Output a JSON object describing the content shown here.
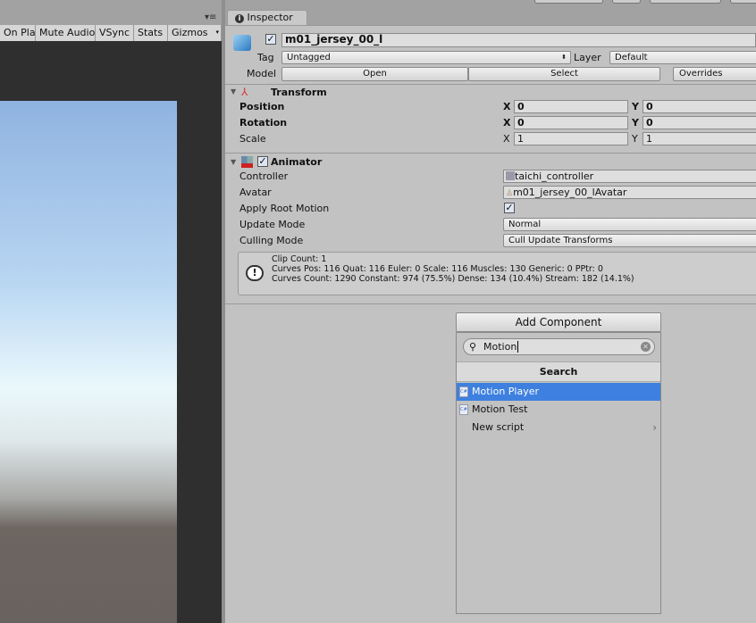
{
  "toolbar": {
    "items": [
      "On Play",
      "Mute Audio",
      "VSync",
      "Stats",
      "Gizmos"
    ]
  },
  "inspector": {
    "tab": "Inspector",
    "object_name": "m01_jersey_00_l",
    "active": true,
    "tag_label": "Tag",
    "tag": "Untagged",
    "layer_label": "Layer",
    "layer": "Default",
    "model_label": "Model",
    "open": "Open",
    "select": "Select",
    "overrides": "Overrides"
  },
  "transform": {
    "title": "Transform",
    "rows": [
      {
        "label": "Position",
        "x": "0",
        "y": "0"
      },
      {
        "label": "Rotation",
        "x": "0",
        "y": "0"
      },
      {
        "label": "Scale",
        "x": "1",
        "y": "1"
      }
    ],
    "x_label": "X",
    "y_label": "Y"
  },
  "animator": {
    "title": "Animator",
    "enabled": true,
    "controller_label": "Controller",
    "controller": "taichi_controller",
    "avatar_label": "Avatar",
    "avatar": "m01_jersey_00_lAvatar",
    "apply_root_label": "Apply Root Motion",
    "apply_root": true,
    "update_label": "Update Mode",
    "update": "Normal",
    "culling_label": "Culling Mode",
    "culling": "Cull Update Transforms",
    "info": [
      "Clip Count: 1",
      "Curves Pos: 116 Quat: 116 Euler: 0 Scale: 116 Muscles: 130 Generic: 0 PPtr: 0",
      "Curves Count: 1290 Constant: 974 (75.5%) Dense: 134 (10.4%) Stream: 182 (14.1%)"
    ]
  },
  "add_component": {
    "button": "Add Component",
    "search_value": "Motion",
    "header": "Search",
    "items": [
      {
        "label": "Motion Player",
        "selected": true
      },
      {
        "label": "Motion Test"
      }
    ],
    "new_script": "New script"
  },
  "colors": {
    "selection": "#3d80df",
    "panel": "#c2c2c2"
  }
}
